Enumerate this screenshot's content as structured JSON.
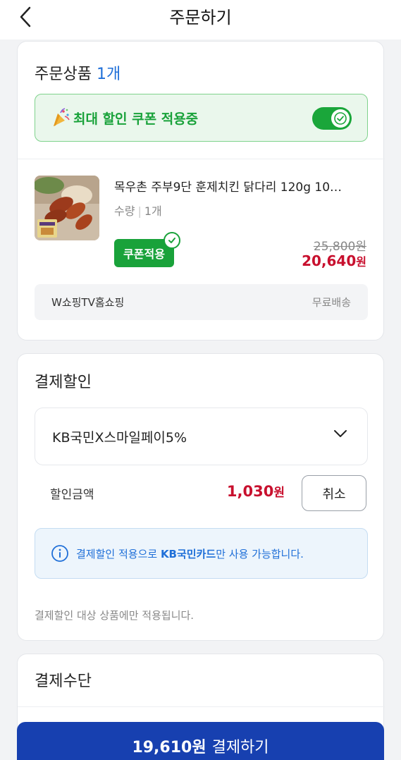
{
  "header": {
    "title": "주문하기"
  },
  "order": {
    "section_title": "주문상품",
    "count": "1개",
    "coupon_banner": "최대 할인 쿠폰 적용중",
    "product": {
      "name": "목우촌 주부9단 훈제치킨 닭다리 120g 10…",
      "qty_label": "수량",
      "qty_value": "1개",
      "coupon_badge": "쿠폰적용",
      "orig_price": "25,800",
      "orig_unit": "원",
      "sale_price": "20,640",
      "sale_unit": "원"
    },
    "seller": "W쇼핑TV홈쇼핑",
    "shipping": "무료배송"
  },
  "payment_discount": {
    "section_title": "결제할인",
    "selected_option": "KB국민X스마일페이5%",
    "amount_label": "할인금액",
    "amount": "1,030",
    "amount_unit": "원",
    "cancel_label": "취소",
    "info_prefix": "결제할인 적용으로 ",
    "info_card": "KB국민카드",
    "info_suffix": "만 사용 가능합니다.",
    "note": "결제할인 대상 상품에만 적용됩니다."
  },
  "payment_method": {
    "section_title": "결제수단"
  },
  "pay_button": {
    "amount": "19,610원",
    "label": "결제하기"
  },
  "colors": {
    "accent_green": "#19a23a",
    "price_red": "#c8102e",
    "link_blue": "#1f6fd8",
    "pay_button_bg": "#1740b0"
  }
}
